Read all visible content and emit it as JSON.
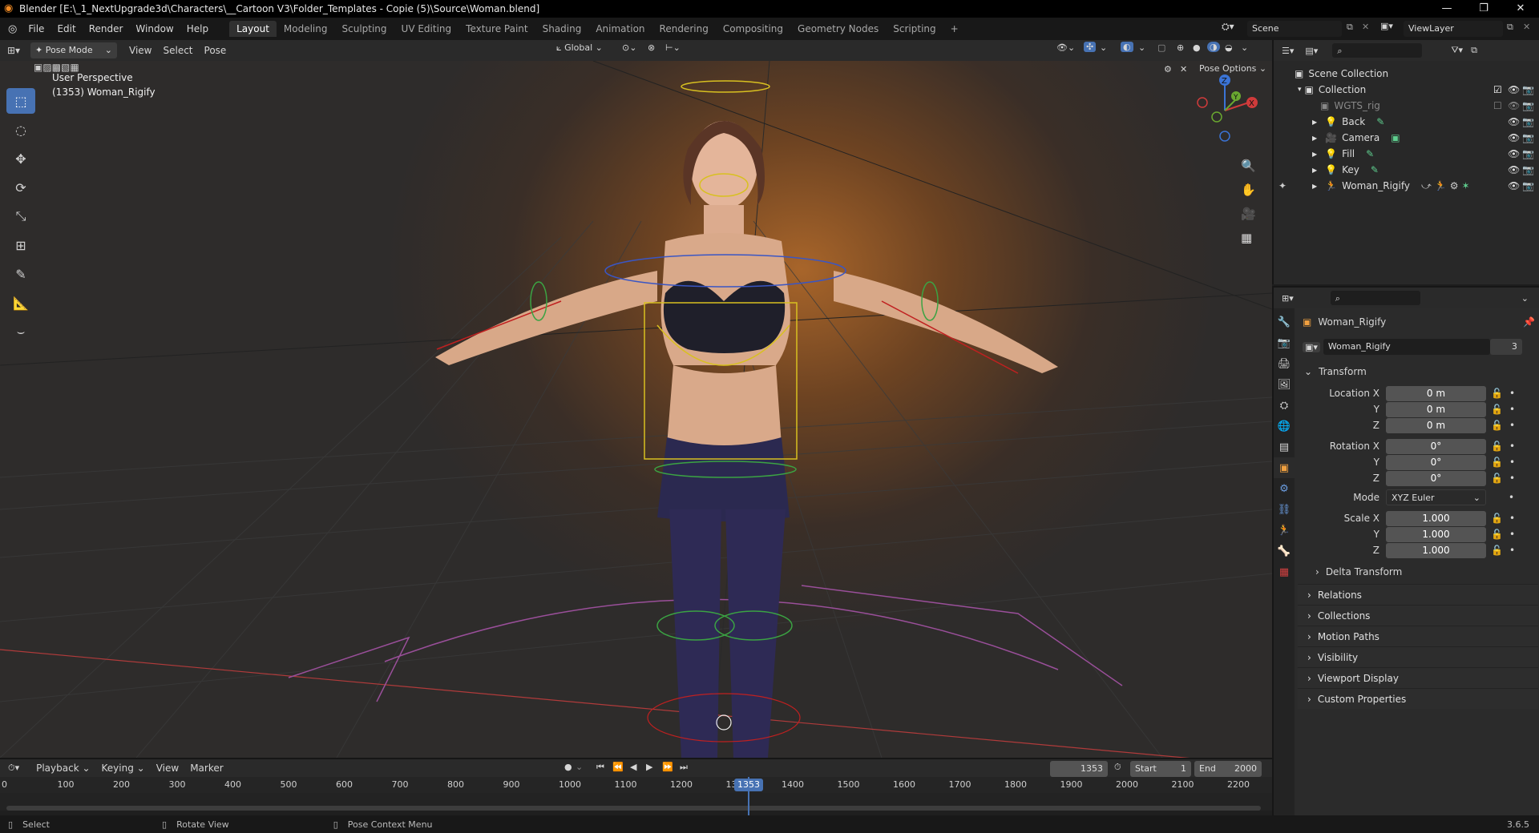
{
  "window": {
    "title": "Blender [E:\\_1_NextUpgrade3d\\Characters\\__Cartoon V3\\Folder_Templates - Copie (5)\\Source\\Woman.blend]",
    "minimize_glyph": "—",
    "maximize_glyph": "❐",
    "close_glyph": "✕"
  },
  "menu": {
    "items": [
      "File",
      "Edit",
      "Render",
      "Window",
      "Help"
    ]
  },
  "workspaces": {
    "tabs": [
      "Layout",
      "Modeling",
      "Sculpting",
      "UV Editing",
      "Texture Paint",
      "Shading",
      "Animation",
      "Rendering",
      "Compositing",
      "Geometry Nodes",
      "Scripting"
    ],
    "active": "Layout",
    "add": "+"
  },
  "scene": {
    "scene_name": "Scene",
    "view_layer": "ViewLayer"
  },
  "viewport_header": {
    "mode": "Pose Mode",
    "menus": [
      "View",
      "Select",
      "Pose"
    ],
    "orientation": "Global",
    "pose_options": "Pose Options"
  },
  "viewport": {
    "perspective": "User Perspective",
    "object_info": "(1353) Woman_Rigify",
    "gizmo": {
      "x": "X",
      "y": "Y",
      "z": "Z"
    }
  },
  "outliner": {
    "root": "Scene Collection",
    "collection": "Collection",
    "items": [
      {
        "name": "WGTS_rig",
        "icon": "collection-icon",
        "dim": true
      },
      {
        "name": "Back",
        "icon": "light-icon"
      },
      {
        "name": "Camera",
        "icon": "camera-icon"
      },
      {
        "name": "Fill",
        "icon": "light-icon"
      },
      {
        "name": "Key",
        "icon": "light-icon"
      },
      {
        "name": "Woman_Rigify",
        "icon": "armature-icon"
      }
    ]
  },
  "properties": {
    "object_name": "Woman_Rigify",
    "data_name": "Woman_Rigify",
    "users": "3",
    "transform_label": "Transform",
    "location": {
      "label": "Location X",
      "y_label": "Y",
      "z_label": "Z",
      "x": "0 m",
      "y": "0 m",
      "z": "0 m"
    },
    "rotation": {
      "label": "Rotation X",
      "y_label": "Y",
      "z_label": "Z",
      "x": "0°",
      "y": "0°",
      "z": "0°"
    },
    "mode_label": "Mode",
    "mode_value": "XYZ Euler",
    "scale": {
      "label": "Scale X",
      "y_label": "Y",
      "z_label": "Z",
      "x": "1.000",
      "y": "1.000",
      "z": "1.000"
    },
    "delta_transform": "Delta Transform",
    "panels": [
      "Relations",
      "Collections",
      "Motion Paths",
      "Visibility",
      "Viewport Display",
      "Custom Properties"
    ]
  },
  "timeline": {
    "menus": [
      "Playback",
      "Keying",
      "View",
      "Marker"
    ],
    "current_frame": "1353",
    "start_label": "Start",
    "start": "1",
    "end_label": "End",
    "end": "2000",
    "ticks": [
      "0",
      "100",
      "200",
      "300",
      "400",
      "500",
      "600",
      "700",
      "800",
      "900",
      "1000",
      "1100",
      "1200",
      "1300",
      "1400",
      "1500",
      "1600",
      "1700",
      "1800",
      "1900",
      "2000",
      "2100",
      "2200"
    ],
    "playhead_label": "1353"
  },
  "statusbar": {
    "select": "Select",
    "rotate": "Rotate View",
    "context": "Pose Context Menu",
    "version": "3.6.5"
  }
}
